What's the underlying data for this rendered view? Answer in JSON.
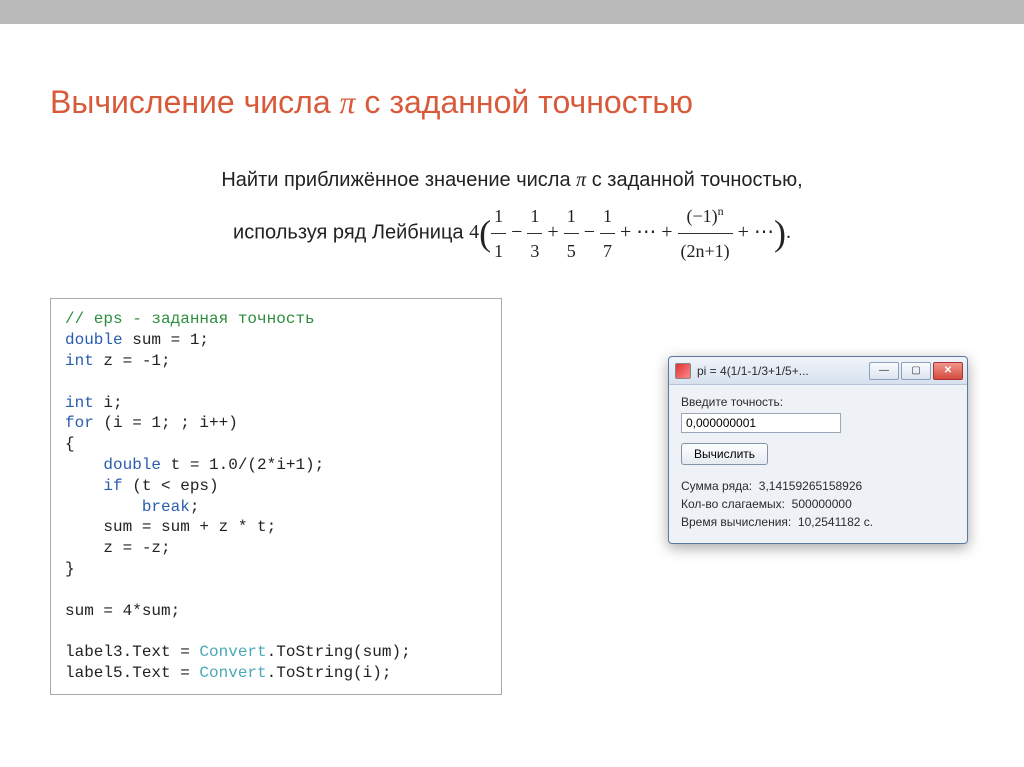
{
  "slide": {
    "title_prefix": "Вычисление числа ",
    "title_pi": "π",
    "title_suffix": " с заданной точностью",
    "problem_line1_prefix": "Найти приближённое значение числа ",
    "problem_line1_pi": "π",
    "problem_line1_suffix": " с заданной точностью,",
    "problem_line2_prefix": "используя ряд Лейбница ",
    "formula": {
      "coef": "4",
      "fr1_num": "1",
      "fr1_den": "1",
      "fr2_num": "1",
      "fr2_den": "3",
      "fr3_num": "1",
      "fr3_den": "5",
      "fr4_num": "1",
      "fr4_den": "7",
      "dots1": "⋯",
      "frk_num_base": "(−1)",
      "frk_num_exp": "n",
      "frk_den": "(2n+1)",
      "dots2": "⋯",
      "period": "."
    }
  },
  "code": {
    "c01": "// eps - заданная точность",
    "kw_double": "double",
    "c02a": " sum = 1;",
    "kw_int": "int",
    "c03a": " z = -1;",
    "c05a": " i;",
    "kw_for": "for",
    "c06a": " (i = 1; ; i++)",
    "c07": "{",
    "c08a": "    ",
    "c08b": " t = 1.0/(2*i+1);",
    "c09a": "    ",
    "kw_if": "if",
    "c09b": " (t < eps)",
    "c10a": "        ",
    "kw_break": "break",
    "c10b": ";",
    "c11": "    sum = sum + z * t;",
    "c12": "    z = -z;",
    "c13": "}",
    "c15": "sum = 4*sum;",
    "c17a": "label3.Text = ",
    "cls_convert": "Convert",
    "c17b": ".ToString(sum);",
    "c18a": "label5.Text = ",
    "c18b": ".ToString(i);"
  },
  "window": {
    "caption": "pi = 4(1/1-1/3+1/5+...",
    "label_precision": "Введите точность:",
    "input_value": "0,000000001",
    "button_compute": "Вычислить",
    "result_sum_label": "Сумма ряда:",
    "result_sum_value": "3,14159265158926",
    "result_count_label": "Кол-во слагаемых:",
    "result_count_value": "500000000",
    "result_time_label": "Время вычисления:",
    "result_time_value": "10,2541182 c."
  }
}
